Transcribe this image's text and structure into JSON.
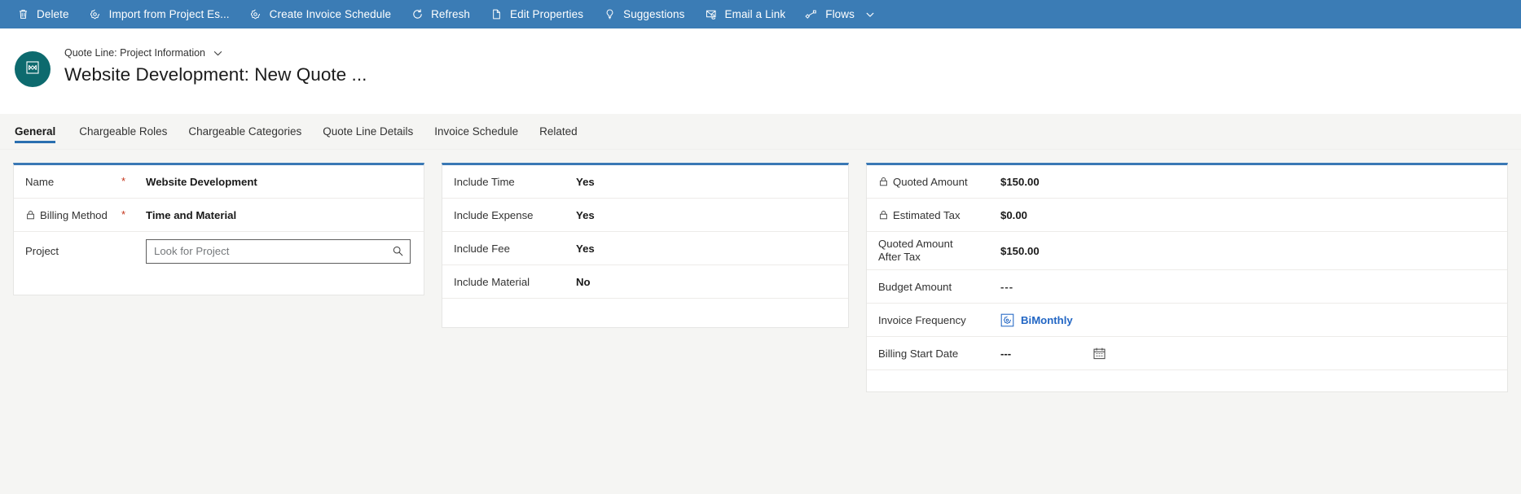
{
  "commandbar": {
    "background": "#3b7cb5",
    "items": [
      {
        "label": "Delete",
        "icon": "trash-icon"
      },
      {
        "label": "Import from Project Es...",
        "icon": "import-icon"
      },
      {
        "label": "Create Invoice Schedule",
        "icon": "gear-icon"
      },
      {
        "label": "Refresh",
        "icon": "refresh-icon"
      },
      {
        "label": "Edit Properties",
        "icon": "page-edit-icon"
      },
      {
        "label": "Suggestions",
        "icon": "lightbulb-icon"
      },
      {
        "label": "Email a Link",
        "icon": "email-link-icon"
      },
      {
        "label": "Flows",
        "icon": "flows-icon",
        "chevron": true
      }
    ]
  },
  "record": {
    "entity_label": "Quote Line: Project Information",
    "title": "Website Development: New Quote ...",
    "avatar_color": "#0d6a6e",
    "avatar_icon": "quote-line-icon"
  },
  "tabs": [
    {
      "label": "General",
      "active": true
    },
    {
      "label": "Chargeable Roles",
      "active": false
    },
    {
      "label": "Chargeable Categories",
      "active": false
    },
    {
      "label": "Quote Line Details",
      "active": false
    },
    {
      "label": "Invoice Schedule",
      "active": false
    },
    {
      "label": "Related",
      "active": false
    }
  ],
  "accent_color": "#3a78b5",
  "columns": {
    "left": {
      "fields": [
        {
          "label": "Name",
          "value": "Website Development",
          "required": true,
          "locked": false
        },
        {
          "label": "Billing Method",
          "value": "Time and Material",
          "required": true,
          "locked": true
        },
        {
          "label": "Project",
          "value": "",
          "placeholder": "Look for Project",
          "required": false,
          "locked": false,
          "type": "lookup"
        }
      ]
    },
    "middle": {
      "fields": [
        {
          "label": "Include Time",
          "value": "Yes"
        },
        {
          "label": "Include Expense",
          "value": "Yes"
        },
        {
          "label": "Include Fee",
          "value": "Yes"
        },
        {
          "label": "Include Material",
          "value": "No"
        }
      ]
    },
    "right": {
      "fields": [
        {
          "label": "Quoted Amount",
          "value": "$150.00",
          "locked": true
        },
        {
          "label": "Estimated Tax",
          "value": "$0.00",
          "locked": true
        },
        {
          "label": "Quoted Amount After Tax",
          "label_line1": "Quoted Amount",
          "label_line2": "After Tax",
          "value": "$150.00",
          "locked": false
        },
        {
          "label": "Budget Amount",
          "value": "---",
          "locked": false
        },
        {
          "label": "Invoice Frequency",
          "value": "BiMonthly",
          "locked": false,
          "type": "optionset",
          "value_color": "#2266c4",
          "icon": "optionset-icon"
        },
        {
          "label": "Billing Start Date",
          "value": "---",
          "locked": false,
          "type": "date",
          "icon": "calendar-icon"
        }
      ]
    }
  }
}
